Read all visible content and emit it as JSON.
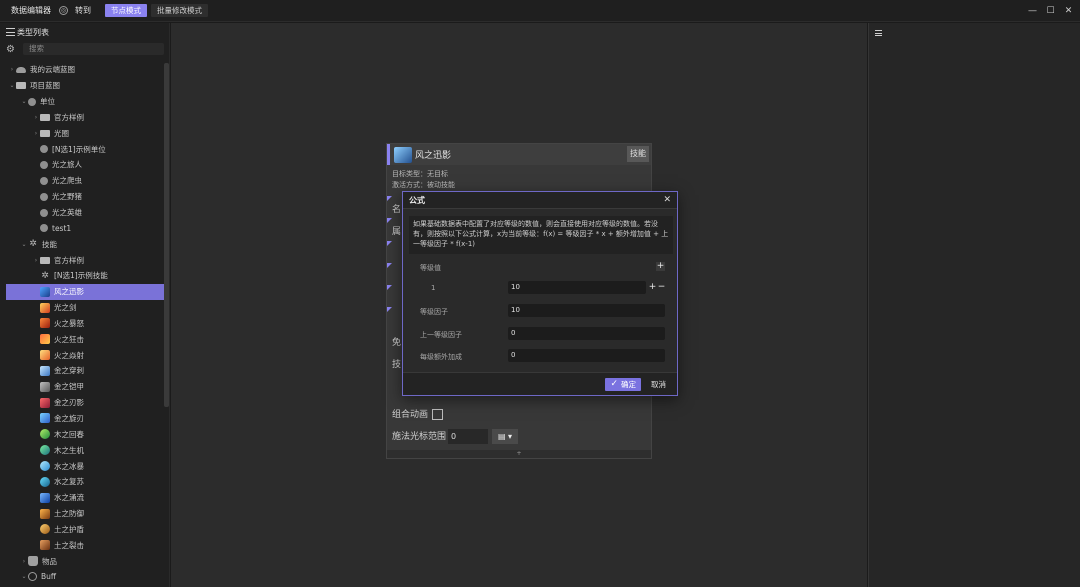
{
  "titlebar": {
    "app_title": "数据编辑器",
    "goto_label": "转到",
    "modes": [
      "节点模式",
      "批量修改模式"
    ]
  },
  "left_panel": {
    "header": "类型列表",
    "search_placeholder": "搜索",
    "tree": [
      {
        "label": "我的云端蓝图",
        "arrow": "›",
        "icon": "cloud",
        "indent": 0
      },
      {
        "label": "项目蓝图",
        "arrow": "⌄",
        "icon": "folder",
        "indent": 0
      },
      {
        "label": "单位",
        "arrow": "⌄",
        "icon": "unit",
        "indent": 1
      },
      {
        "label": "官方样例",
        "arrow": "›",
        "icon": "folder",
        "indent": 2
      },
      {
        "label": "光圈",
        "arrow": "›",
        "icon": "folder",
        "indent": 2
      },
      {
        "label": "[N选1]示例单位",
        "arrow": "",
        "icon": "unit",
        "indent": 2
      },
      {
        "label": "光之旅人",
        "arrow": "",
        "icon": "unit",
        "indent": 2
      },
      {
        "label": "光之爬虫",
        "arrow": "",
        "icon": "unit",
        "indent": 2
      },
      {
        "label": "光之野猪",
        "arrow": "",
        "icon": "unit",
        "indent": 2
      },
      {
        "label": "光之英雄",
        "arrow": "",
        "icon": "unit",
        "indent": 2
      },
      {
        "label": "test1",
        "arrow": "",
        "icon": "unit",
        "indent": 2
      },
      {
        "label": "技能",
        "arrow": "⌄",
        "icon": "skill",
        "indent": 1
      },
      {
        "label": "官方样例",
        "arrow": "›",
        "icon": "folder",
        "indent": 2
      },
      {
        "label": "[N选1]示例技能",
        "arrow": "",
        "icon": "skill",
        "indent": 2
      },
      {
        "label": "风之迅影",
        "arrow": "",
        "icon": "s1",
        "indent": 2,
        "selected": true
      },
      {
        "label": "光之剑",
        "arrow": "",
        "icon": "s2",
        "indent": 2
      },
      {
        "label": "火之暴怒",
        "arrow": "",
        "icon": "s3",
        "indent": 2
      },
      {
        "label": "火之狂击",
        "arrow": "",
        "icon": "s4",
        "indent": 2
      },
      {
        "label": "火之焱射",
        "arrow": "",
        "icon": "s5",
        "indent": 2
      },
      {
        "label": "金之穿刺",
        "arrow": "",
        "icon": "s6",
        "indent": 2
      },
      {
        "label": "金之铠甲",
        "arrow": "",
        "icon": "s7",
        "indent": 2
      },
      {
        "label": "金之刃影",
        "arrow": "",
        "icon": "s8",
        "indent": 2
      },
      {
        "label": "金之旋刃",
        "arrow": "",
        "icon": "s9",
        "indent": 2
      },
      {
        "label": "木之回春",
        "arrow": "",
        "icon": "s10",
        "indent": 2
      },
      {
        "label": "木之生机",
        "arrow": "",
        "icon": "s11",
        "indent": 2
      },
      {
        "label": "水之冰暴",
        "arrow": "",
        "icon": "s12",
        "indent": 2
      },
      {
        "label": "水之复苏",
        "arrow": "",
        "icon": "s13",
        "indent": 2
      },
      {
        "label": "水之涌流",
        "arrow": "",
        "icon": "s14",
        "indent": 2
      },
      {
        "label": "土之防御",
        "arrow": "",
        "icon": "s15",
        "indent": 2
      },
      {
        "label": "土之护盾",
        "arrow": "",
        "icon": "s16",
        "indent": 2
      },
      {
        "label": "土之裂击",
        "arrow": "",
        "icon": "s17",
        "indent": 2
      },
      {
        "label": "物品",
        "arrow": "›",
        "icon": "bag",
        "indent": 1
      },
      {
        "label": "Buff",
        "arrow": "⌄",
        "icon": "buff",
        "indent": 1
      }
    ]
  },
  "node": {
    "title": "风之迅影",
    "tag": "技能",
    "target_type": "目标类型：无目标",
    "activation": "激活方式：被动技能",
    "row_labels": [
      "名",
      "属",
      "免",
      "技"
    ],
    "combo_label": "组合动画",
    "cursor_label": "施法光标范围",
    "cursor_value": "0",
    "footer": "+"
  },
  "modal": {
    "title": "公式",
    "description": "如果基础数据表中配置了对应等级的数值，则会直接使用对应等级的数值。若没有，则按照以下公式计算，x为当前等级：f(x) = 等级因子 * x + 额外增加值 + 上一等级因子 * f(x-1)",
    "level_value_label": "等级值",
    "level_index": "1",
    "level_value": "10",
    "level_factor_label": "等级因子",
    "level_factor_value": "10",
    "prev_factor_label": "上一等级因子",
    "prev_factor_value": "0",
    "extra_label": "每级额外加成",
    "extra_value": "0",
    "ok_label": "确定",
    "cancel_label": "取消"
  }
}
